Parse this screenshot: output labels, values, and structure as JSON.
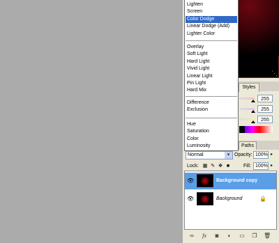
{
  "blend_menu": {
    "groups": [
      [
        "Lighten",
        "Screen",
        "Color Dodge",
        "Linear Dodge (Add)",
        "Lighter Color"
      ],
      [
        "Overlay",
        "Soft Light",
        "Hard Light",
        "Vivid Light",
        "Linear Light",
        "Pin Light",
        "Hard Mix"
      ],
      [
        "Difference",
        "Exclusion"
      ],
      [
        "Hue",
        "Saturation",
        "Color",
        "Luminosity"
      ]
    ],
    "selected": "Color Dodge"
  },
  "styles_panel": {
    "tab_label": "Styles",
    "channel_values": [
      "255",
      "255",
      "255"
    ]
  },
  "layers_panel": {
    "paths_tab": "Paths",
    "blend_mode": "Normal",
    "opacity_label": "Opacity:",
    "opacity_value": "100%",
    "lock_label": "Lock:",
    "fill_label": "Fill:",
    "fill_value": "100%",
    "layers": [
      {
        "name": "Background copy",
        "active": true,
        "locked": false
      },
      {
        "name": "Background",
        "active": false,
        "locked": true
      }
    ]
  },
  "colors": {
    "selection": "#3169c6",
    "active_layer": "#5a9ee8"
  },
  "icons": [
    "eye-icon",
    "lock-transparent-icon",
    "brush-icon",
    "move-icon",
    "lock-all-icon",
    "link-icon",
    "fx-icon",
    "mask-icon",
    "adjustment-icon",
    "folder-icon",
    "new-layer-icon",
    "trash-icon"
  ]
}
